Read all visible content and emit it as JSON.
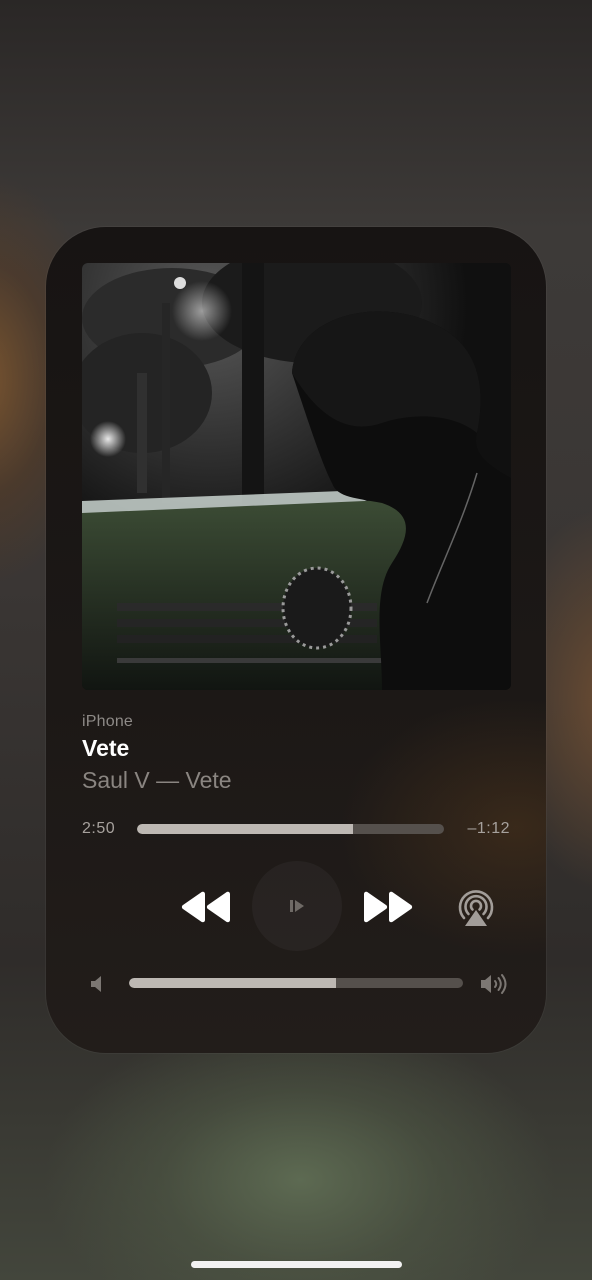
{
  "now_playing": {
    "source": "iPhone",
    "title": "Vete",
    "artist_line": "Saul V — Vete",
    "elapsed": "2:50",
    "remaining": "–1:12",
    "progress_fraction": 0.703,
    "volume_fraction": 0.62
  },
  "icons": {
    "rewind": "rewind-icon",
    "play": "play-icon",
    "fast_forward": "fast-forward-icon",
    "airplay": "airplay-icon",
    "volume_low": "speaker-low-icon",
    "volume_high": "speaker-high-icon"
  }
}
